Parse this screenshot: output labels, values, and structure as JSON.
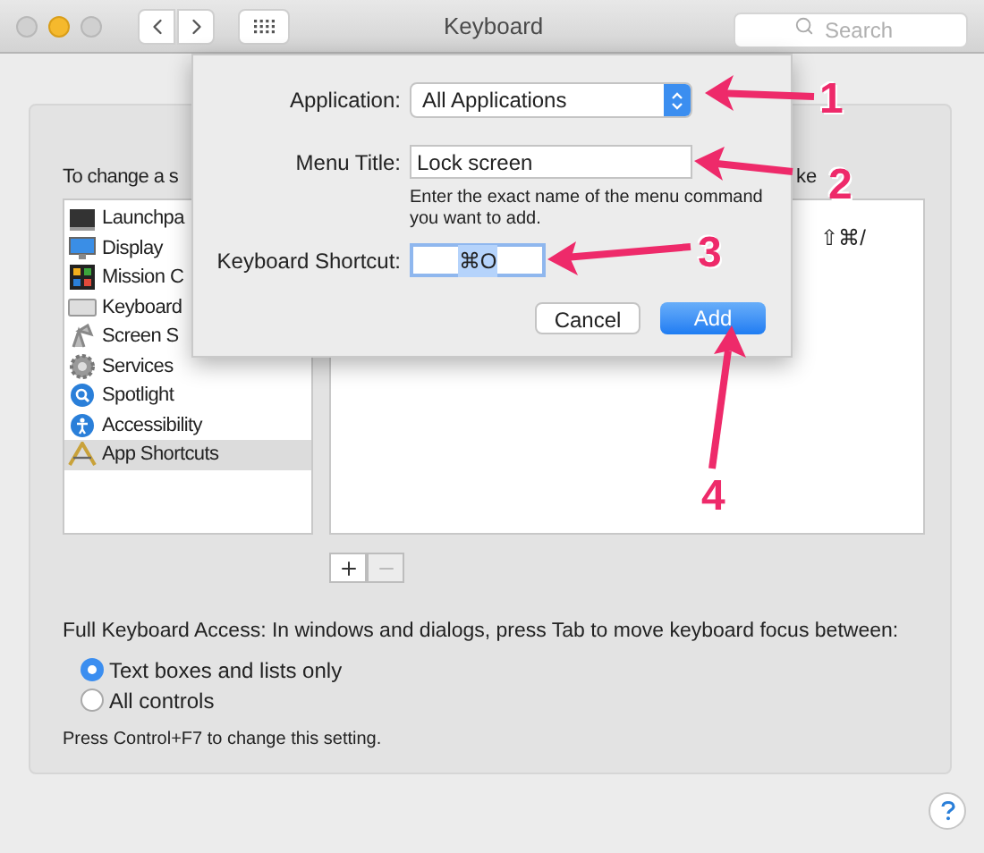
{
  "window": {
    "title": "Keyboard",
    "search": {
      "placeholder": "Search"
    }
  },
  "panel": {
    "instruction": "To change a s",
    "column_2_header": "ke",
    "categories": [
      {
        "label": "Launchpa",
        "selected": false
      },
      {
        "label": "Display",
        "selected": false
      },
      {
        "label": "Mission C",
        "selected": false
      },
      {
        "label": "Keyboard",
        "selected": false
      },
      {
        "label": "Screen S",
        "selected": false
      },
      {
        "label": "Services",
        "selected": false
      },
      {
        "label": "Spotlight",
        "selected": false
      },
      {
        "label": "Accessibility",
        "selected": false
      },
      {
        "label": "App Shortcuts",
        "selected": true
      }
    ],
    "shortcuts": [
      {
        "keys": "⇧⌘/"
      }
    ],
    "list_buttons": [
      {
        "kind": "add",
        "disabled": false
      },
      {
        "kind": "remove",
        "disabled": true
      }
    ],
    "full_keyboard_access": {
      "label": "Full Keyboard Access: In windows and dialogs, press Tab to move keyboard focus between:",
      "options": [
        {
          "label": "Text boxes and lists only",
          "selected": true
        },
        {
          "label": "All controls",
          "selected": false
        }
      ],
      "note": "Press Control+F7 to change this setting."
    }
  },
  "dialog": {
    "application": {
      "label": "Application:",
      "value": "All Applications"
    },
    "menu_title": {
      "label": "Menu Title:",
      "value": "Lock screen"
    },
    "hint": "Enter the exact name of the menu command you want to add.",
    "keyboard_shortcut": {
      "label": "Keyboard Shortcut:",
      "value": "⌘O",
      "selected": true
    },
    "buttons": [
      {
        "label": "Cancel",
        "kind": "secondary"
      },
      {
        "label": "Add",
        "kind": "default"
      }
    ]
  },
  "annotations": [
    {
      "label": "1"
    },
    {
      "label": "2"
    },
    {
      "label": "3"
    },
    {
      "label": "4"
    }
  ]
}
